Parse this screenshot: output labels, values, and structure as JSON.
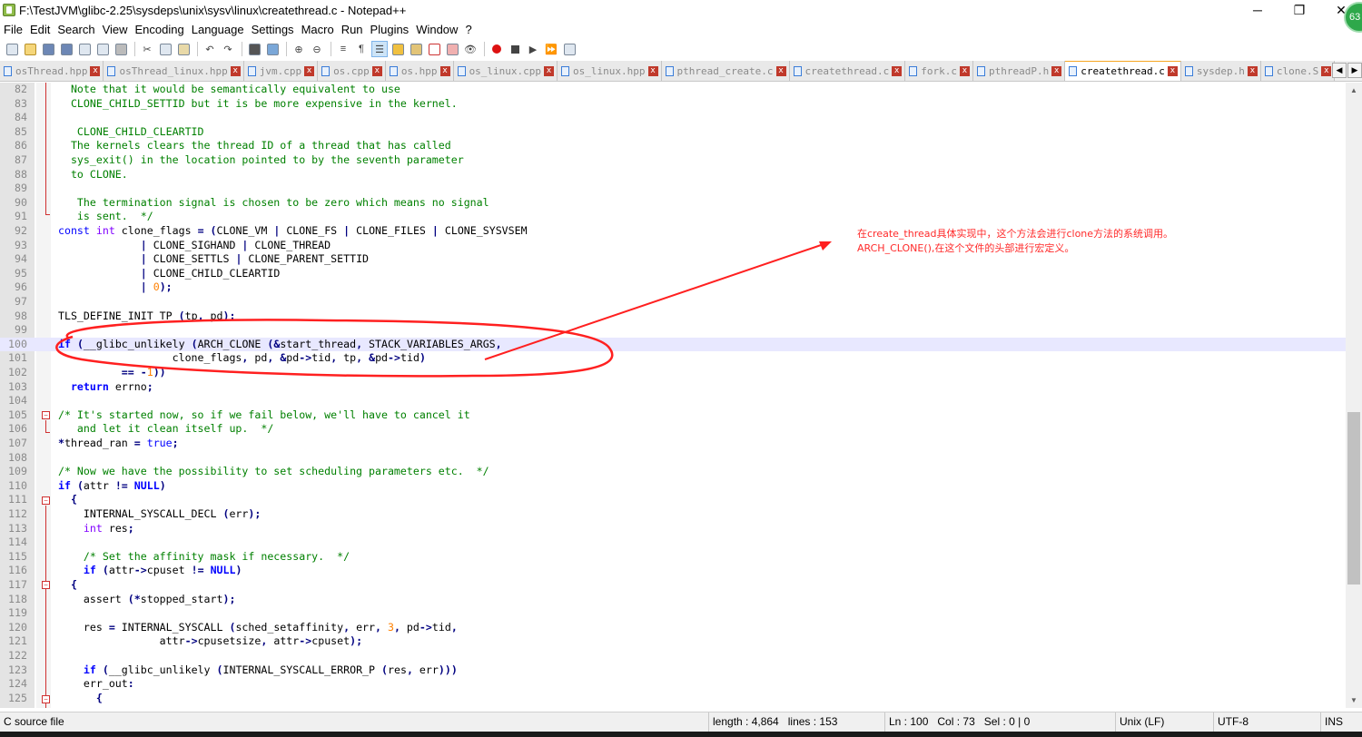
{
  "window": {
    "title": "F:\\TestJVM\\glibc-2.25\\sysdeps\\unix\\sysv\\linux\\createthread.c - Notepad++",
    "minimize": "─",
    "maximize": "❐",
    "close": "✕",
    "badge": "63"
  },
  "menu": [
    "File",
    "Edit",
    "Search",
    "View",
    "Encoding",
    "Language",
    "Settings",
    "Macro",
    "Run",
    "Plugins",
    "Window",
    "?"
  ],
  "tabs": [
    {
      "label": "osThread.hpp",
      "active": false
    },
    {
      "label": "osThread_linux.hpp",
      "active": false
    },
    {
      "label": "jvm.cpp",
      "active": false
    },
    {
      "label": "os.cpp",
      "active": false
    },
    {
      "label": "os.hpp",
      "active": false
    },
    {
      "label": "os_linux.cpp",
      "active": false
    },
    {
      "label": "os_linux.hpp",
      "active": false
    },
    {
      "label": "pthread_create.c",
      "active": false
    },
    {
      "label": "createthread.c",
      "active": false
    },
    {
      "label": "fork.c",
      "active": false
    },
    {
      "label": "pthreadP.h",
      "active": false
    },
    {
      "label": "createthread.c",
      "active": true
    },
    {
      "label": "sysdep.h",
      "active": false
    },
    {
      "label": "clone.S",
      "active": false
    }
  ],
  "tab_nav": {
    "prev": "◀",
    "next": "▶"
  },
  "editor": {
    "current_line": 100,
    "lines": [
      {
        "n": "82",
        "html": "<span class='cm'>   Note that it would be semantically equivalent to use</span>"
      },
      {
        "n": "83",
        "html": "<span class='cm'>   CLONE_CHILD_SETTID but it is be more expensive in the kernel.</span>"
      },
      {
        "n": "84",
        "html": ""
      },
      {
        "n": "85",
        "html": "<span class='cm'>    CLONE_CHILD_CLEARTID</span>"
      },
      {
        "n": "86",
        "html": "<span class='cm'>   The kernels clears the thread ID of a thread that has called</span>"
      },
      {
        "n": "87",
        "html": "<span class='cm'>   sys_exit() in the location pointed to by the seventh parameter</span>"
      },
      {
        "n": "88",
        "html": "<span class='cm'>   to CLONE.</span>"
      },
      {
        "n": "89",
        "html": ""
      },
      {
        "n": "90",
        "html": "<span class='cm'>    The termination signal is chosen to be zero which means no signal</span>"
      },
      {
        "n": "91",
        "html": "<span class='cm'>    is sent.  */</span>"
      },
      {
        "n": "92",
        "html": " <span class='nk'>const</span> <span class='ty'>int</span> clone_flags <span class='op'>=</span> <span class='op'>(</span>CLONE_VM <span class='op'>|</span> CLONE_FS <span class='op'>|</span> CLONE_FILES <span class='op'>|</span> CLONE_SYSVSEM"
      },
      {
        "n": "93",
        "html": "              <span class='op'>|</span> CLONE_SIGHAND <span class='op'>|</span> CLONE_THREAD"
      },
      {
        "n": "94",
        "html": "              <span class='op'>|</span> CLONE_SETTLS <span class='op'>|</span> CLONE_PARENT_SETTID"
      },
      {
        "n": "95",
        "html": "              <span class='op'>|</span> CLONE_CHILD_CLEARTID"
      },
      {
        "n": "96",
        "html": "              <span class='op'>|</span> <span class='num'>0</span><span class='op'>);</span>"
      },
      {
        "n": "97",
        "html": ""
      },
      {
        "n": "98",
        "html": " TLS_DEFINE_INIT_TP <span class='op'>(</span>tp<span class='op'>,</span> pd<span class='op'>);</span>"
      },
      {
        "n": "99",
        "html": ""
      },
      {
        "n": "100",
        "html": " <span class='kw'>if</span> <span class='op'>(</span>__glibc_unlikely <span class='op'>(</span>ARCH_CLONE <span class='op'>(&amp;</span>start_thread<span class='op'>,</span> STACK_VARIABLES_ARGS<span class='op'>,</span>"
      },
      {
        "n": "101",
        "html": "                   clone_flags<span class='op'>,</span> pd<span class='op'>,</span> <span class='op'>&amp;</span>pd<span class='op'>-&gt;</span>tid<span class='op'>,</span> tp<span class='op'>,</span> <span class='op'>&amp;</span>pd<span class='op'>-&gt;</span>tid<span class='op'>)</span>"
      },
      {
        "n": "102",
        "html": "           <span class='op'>==</span> <span class='op'>-</span><span class='num'>1</span><span class='op'>))</span>"
      },
      {
        "n": "103",
        "html": "   <span class='kw'>return</span> errno<span class='op'>;</span>"
      },
      {
        "n": "104",
        "html": ""
      },
      {
        "n": "105",
        "html": " <span class='cm'>/* It's started now, so if we fail below, we'll have to cancel it</span>"
      },
      {
        "n": "106",
        "html": "<span class='cm'>    and let it clean itself up.  */</span>"
      },
      {
        "n": "107",
        "html": " <span class='op'>*</span>thread_ran <span class='op'>=</span> <span class='nk'>true</span><span class='op'>;</span>"
      },
      {
        "n": "108",
        "html": ""
      },
      {
        "n": "109",
        "html": " <span class='cm'>/* Now we have the possibility to set scheduling parameters etc.  */</span>"
      },
      {
        "n": "110",
        "html": " <span class='kw'>if</span> <span class='op'>(</span>attr <span class='op'>!=</span> <span class='kw'>NULL</span><span class='op'>)</span>"
      },
      {
        "n": "111",
        "html": "   <span class='op'>{</span>"
      },
      {
        "n": "112",
        "html": "     INTERNAL_SYSCALL_DECL <span class='op'>(</span>err<span class='op'>);</span>"
      },
      {
        "n": "113",
        "html": "     <span class='ty'>int</span> res<span class='op'>;</span>"
      },
      {
        "n": "114",
        "html": ""
      },
      {
        "n": "115",
        "html": "     <span class='cm'>/* Set the affinity mask if necessary.  */</span>"
      },
      {
        "n": "116",
        "html": "     <span class='kw'>if</span> <span class='op'>(</span>attr<span class='op'>-&gt;</span>cpuset <span class='op'>!=</span> <span class='kw'>NULL</span><span class='op'>)</span>"
      },
      {
        "n": "117",
        "html": "   <span class='op'>{</span>"
      },
      {
        "n": "118",
        "html": "     assert <span class='op'>(*</span>stopped_start<span class='op'>);</span>"
      },
      {
        "n": "119",
        "html": ""
      },
      {
        "n": "120",
        "html": "     res <span class='op'>=</span> INTERNAL_SYSCALL <span class='op'>(</span>sched_setaffinity<span class='op'>,</span> err<span class='op'>,</span> <span class='num'>3</span><span class='op'>,</span> pd<span class='op'>-&gt;</span>tid<span class='op'>,</span>"
      },
      {
        "n": "121",
        "html": "                 attr<span class='op'>-&gt;</span>cpusetsize<span class='op'>,</span> attr<span class='op'>-&gt;</span>cpuset<span class='op'>);</span>"
      },
      {
        "n": "122",
        "html": ""
      },
      {
        "n": "123",
        "html": "     <span class='kw'>if</span> <span class='op'>(</span>__glibc_unlikely <span class='op'>(</span>INTERNAL_SYSCALL_ERROR_P <span class='op'>(</span>res<span class='op'>,</span> err<span class='op'>)))</span>"
      },
      {
        "n": "124",
        "html": "     err_out<span class='op'>:</span>"
      },
      {
        "n": "125",
        "html": "       <span class='op'>{</span>"
      }
    ]
  },
  "annotation": {
    "line1": "在create_thread具体实现中，这个方法会进行clone方法的系统调用。",
    "line2": "ARCH_CLONE(),在这个文件的头部进行宏定义。",
    "color": "#ff2a2a"
  },
  "scrollbar": {
    "up": "▲",
    "down": "▼"
  },
  "status": {
    "file_type": "C source file",
    "length": "length : 4,864",
    "lines": "lines : 153",
    "ln": "Ln : 100",
    "col": "Col : 73",
    "sel": "Sel : 0 | 0",
    "eol": "Unix (LF)",
    "encoding": "UTF-8",
    "mode": "INS"
  }
}
